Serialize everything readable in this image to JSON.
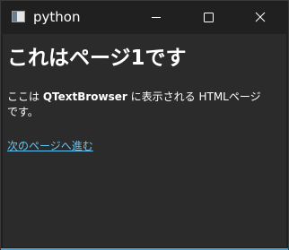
{
  "window": {
    "title": "python",
    "controls": {
      "minimize": "minimize-icon",
      "maximize": "maximize-icon",
      "close": "close-icon"
    }
  },
  "page": {
    "heading": "これはページ1です",
    "paragraph": {
      "prefix": "ここは ",
      "bold": "QTextBrowser",
      "suffix": " に表示される HTMLページです。"
    },
    "link": "次のページへ進む"
  },
  "colors": {
    "link": "#63c6f2",
    "background": "#2b2b2b",
    "titlebar": "#202020"
  }
}
